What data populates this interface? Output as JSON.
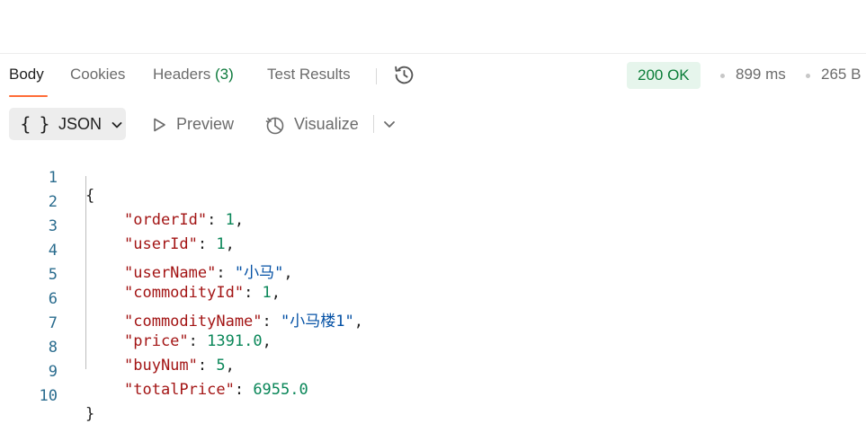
{
  "tabs": [
    {
      "label": "Body",
      "active": true
    },
    {
      "label": "Cookies",
      "active": false
    },
    {
      "label": "Headers",
      "count": "(3)",
      "active": false
    },
    {
      "label": "Test Results",
      "active": false
    }
  ],
  "history_icon": "history-icon",
  "status": {
    "code_text": "200 OK",
    "time": "899 ms",
    "size": "265 B"
  },
  "toolbar": {
    "format_braces": "{ }",
    "format_label": "JSON",
    "preview_label": "Preview",
    "visualize_label": "Visualize"
  },
  "code": {
    "line_numbers": [
      "1",
      "2",
      "3",
      "4",
      "5",
      "6",
      "7",
      "8",
      "9",
      "10"
    ],
    "open_brace": "{",
    "close_brace": "}",
    "entries": [
      {
        "key": "\"orderId\"",
        "value": "1",
        "type": "num",
        "comma": ","
      },
      {
        "key": "\"userId\"",
        "value": "1",
        "type": "num",
        "comma": ","
      },
      {
        "key": "\"userName\"",
        "value": "\"小马\"",
        "type": "str",
        "comma": ","
      },
      {
        "key": "\"commodityId\"",
        "value": "1",
        "type": "num",
        "comma": ","
      },
      {
        "key": "\"commodityName\"",
        "value": "\"小马楼1\"",
        "type": "str",
        "comma": ","
      },
      {
        "key": "\"price\"",
        "value": "1391.0",
        "type": "num",
        "comma": ","
      },
      {
        "key": "\"buyNum\"",
        "value": "5",
        "type": "num",
        "comma": ","
      },
      {
        "key": "\"totalPrice\"",
        "value": "6955.0",
        "type": "num",
        "comma": ""
      }
    ]
  },
  "colors": {
    "accent": "#ff6c37",
    "status_bg": "#e6f5ec",
    "status_text": "#0a7d38",
    "key": "#a31515",
    "string": "#0451a5",
    "number": "#098658"
  }
}
